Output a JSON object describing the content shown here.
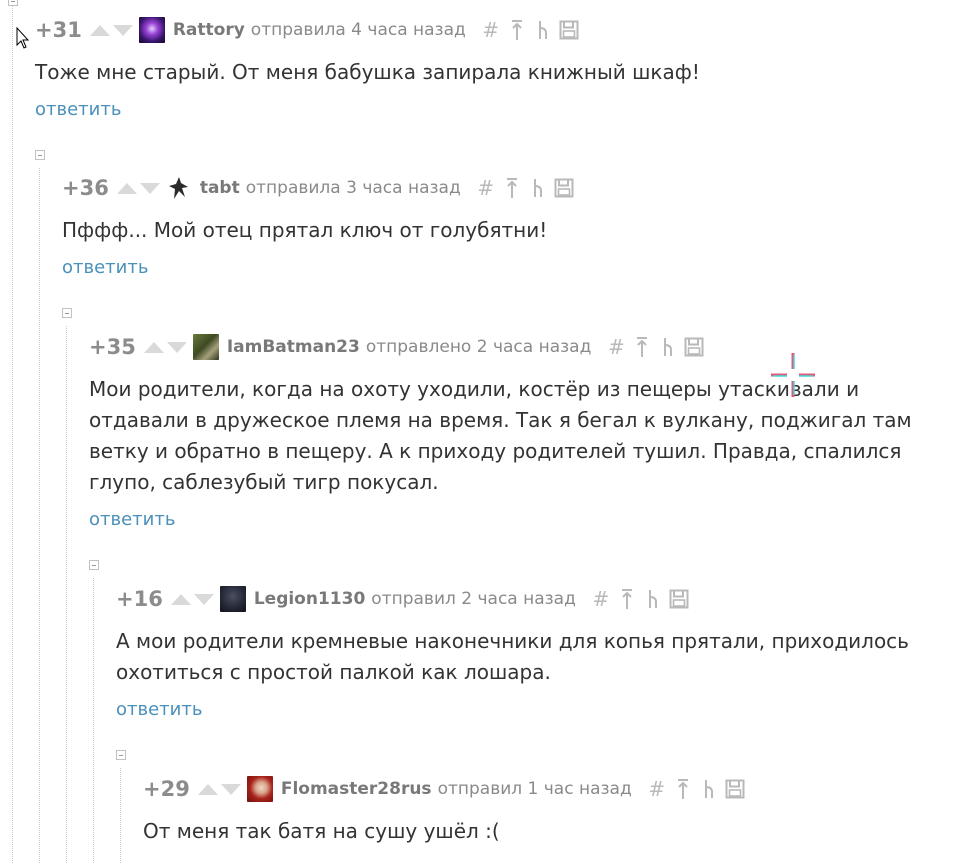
{
  "colors": {
    "rating": "#8c8c8c",
    "nick": "#797979",
    "meta": "#8a8a8a",
    "text": "#333333",
    "reply_link": "#4a90ba",
    "vote_arrow": "#d9d9d9",
    "tool_icon": "#b9b9b9",
    "thread_line": "#c9c9c9"
  },
  "comments": [
    {
      "rating": "+31",
      "nick": "Rattory",
      "meta": "отправила 4 часа назад",
      "text": "Тоже мне старый. От меня бабушка запирала книжный шкаф!",
      "reply": "ответить",
      "avatar_icon": "purple-galaxy-avatar"
    },
    {
      "rating": "+36",
      "nick": "tabt",
      "meta": "отправила 3 часа назад",
      "text": "Пффф... Мой отец прятал ключ от голубятни!",
      "reply": "ответить",
      "avatar_icon": "silhouette-avatar"
    },
    {
      "rating": "+35",
      "nick": "IamBatman23",
      "meta": "отправлено 2 часа назад",
      "text": "Мои родители, когда на охоту уходили, костёр из пещеры утаскивали и отдавали в дружеское племя на время. Так я бегал к вулкану, поджигал там ветку и обратно в пещеру. А к приходу родителей тушил. Правда, спалился глупо, саблезубый тигр покусал.",
      "reply": "ответить",
      "avatar_icon": "green-photo-avatar"
    },
    {
      "rating": "+16",
      "nick": "Legion1130",
      "meta": "отправил 2 часа назад",
      "text": "А мои родители кремневые наконечники для копья прятали, приходилось охотиться с простой палкой как лошара.",
      "reply": "ответить",
      "avatar_icon": "dark-figure-avatar"
    },
    {
      "rating": "+29",
      "nick": "Flomaster28rus",
      "meta": "отправил 1 час назад",
      "text": "От меня так батя на сушу ушёл :(",
      "reply": "",
      "avatar_icon": "red-hair-avatar"
    }
  ],
  "tool_icons": [
    "hash-icon",
    "arrow-up-icon",
    "branch-icon",
    "save-icon"
  ]
}
